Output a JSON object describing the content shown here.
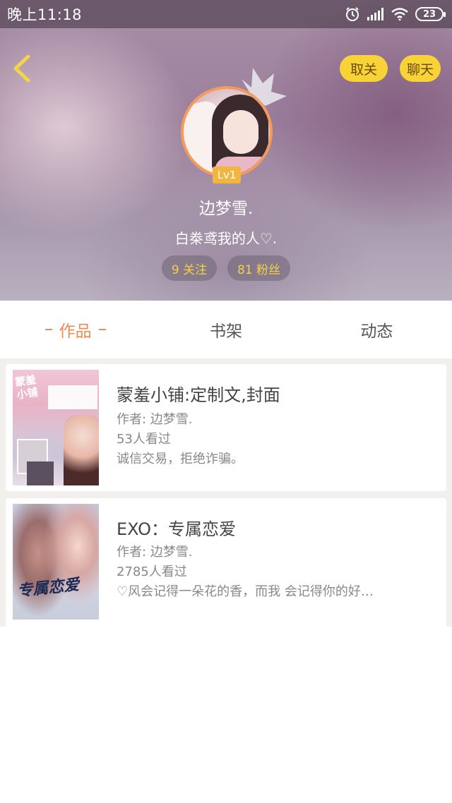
{
  "status_bar": {
    "time": "晚上11:18",
    "battery": "23",
    "icons": [
      "alarm-icon",
      "signal-icon",
      "wifi-icon",
      "battery-icon"
    ]
  },
  "header": {
    "back_icon": "chevron-left-icon",
    "unfollow_label": "取关",
    "chat_label": "聊天",
    "level": "Lv1",
    "username": "边梦雪.",
    "signature": "白桊鸢我的人♡.",
    "stats": {
      "following": "9 关注",
      "fans": "81 粉丝"
    }
  },
  "tabs": [
    {
      "label": "作品",
      "active": true
    },
    {
      "label": "书架",
      "active": false
    },
    {
      "label": "动态",
      "active": false
    }
  ],
  "works": [
    {
      "title": "蒙羞小铺:定制文,封面",
      "author": "作者: 边梦雪.",
      "views": "53人看过",
      "desc": "诚信交易，拒绝诈骗。",
      "cover_text": "蒙羞小铺"
    },
    {
      "title": "EXO：专属恋爱",
      "author": "作者: 边梦雪.",
      "views": "2785人看过",
      "desc": "♡风会记得一朵花的香，而我 会记得你的好…",
      "cover_text": "专属恋爱"
    }
  ],
  "colors": {
    "accent": "#ef8a55",
    "button_yellow": "#f7d338",
    "stat_text": "#f6d04a"
  }
}
